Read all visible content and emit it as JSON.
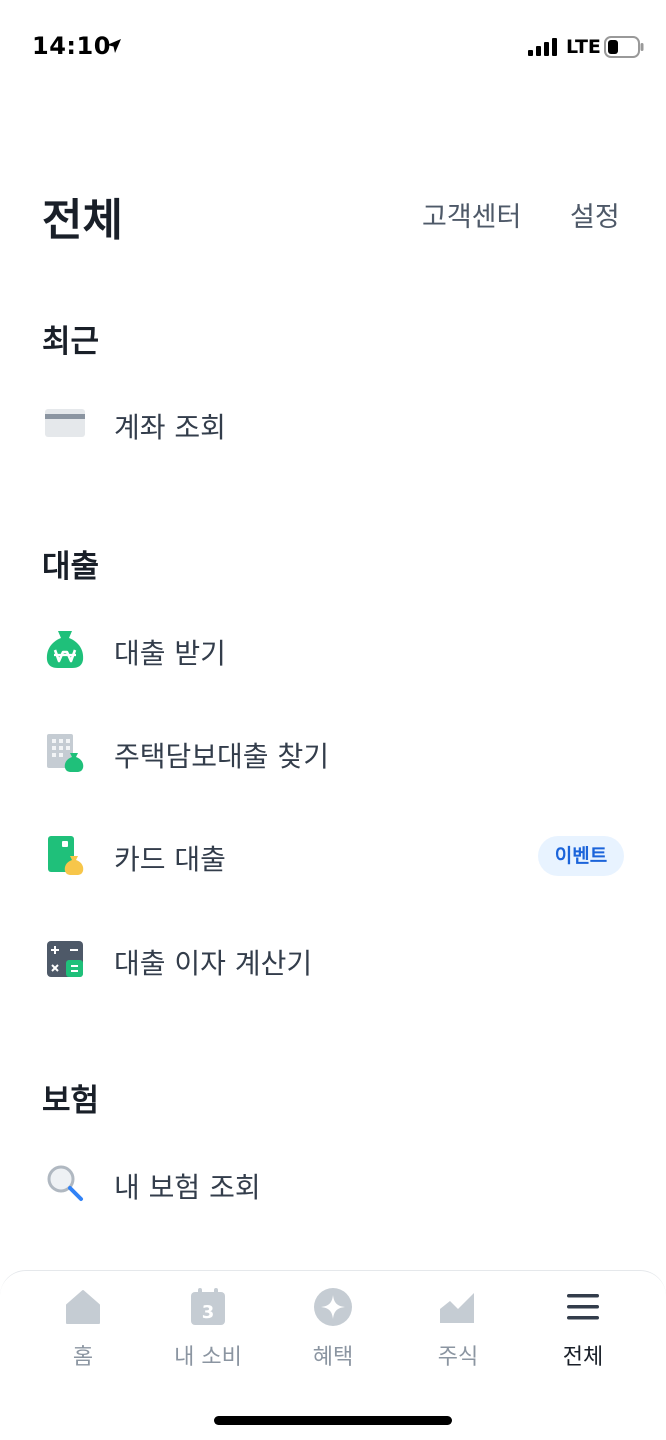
{
  "status_bar": {
    "time": "14:10",
    "network": "LTE"
  },
  "header": {
    "title": "전체",
    "help_label": "고객센터",
    "settings_label": "설정"
  },
  "sections": [
    {
      "title": "최근",
      "items": [
        {
          "label": "계좌 조회",
          "icon": "card-icon"
        }
      ]
    },
    {
      "title": "대출",
      "items": [
        {
          "label": "대출 받기",
          "icon": "money-bag-won-icon"
        },
        {
          "label": "주택담보대출 찾기",
          "icon": "building-loan-icon"
        },
        {
          "label": "카드 대출",
          "icon": "card-loan-icon",
          "badge": "이벤트"
        },
        {
          "label": "대출 이자 계산기",
          "icon": "calculator-icon"
        }
      ]
    },
    {
      "title": "보험",
      "items": [
        {
          "label": "내 보험 조회",
          "icon": "search-icon"
        }
      ]
    }
  ],
  "bottom_nav": {
    "items": [
      {
        "label": "홈",
        "icon": "home-icon"
      },
      {
        "label": "내 소비",
        "icon": "calendar-icon",
        "icon_text": "3"
      },
      {
        "label": "혜택",
        "icon": "sparkle-icon"
      },
      {
        "label": "주식",
        "icon": "stock-chart-icon"
      },
      {
        "label": "전체",
        "icon": "menu-icon",
        "active": true
      }
    ]
  },
  "colors": {
    "accent": "#1b64da",
    "green": "#1fc07a",
    "text": "#191f28",
    "sub_text": "#4e5968",
    "inactive": "#8b95a1"
  }
}
